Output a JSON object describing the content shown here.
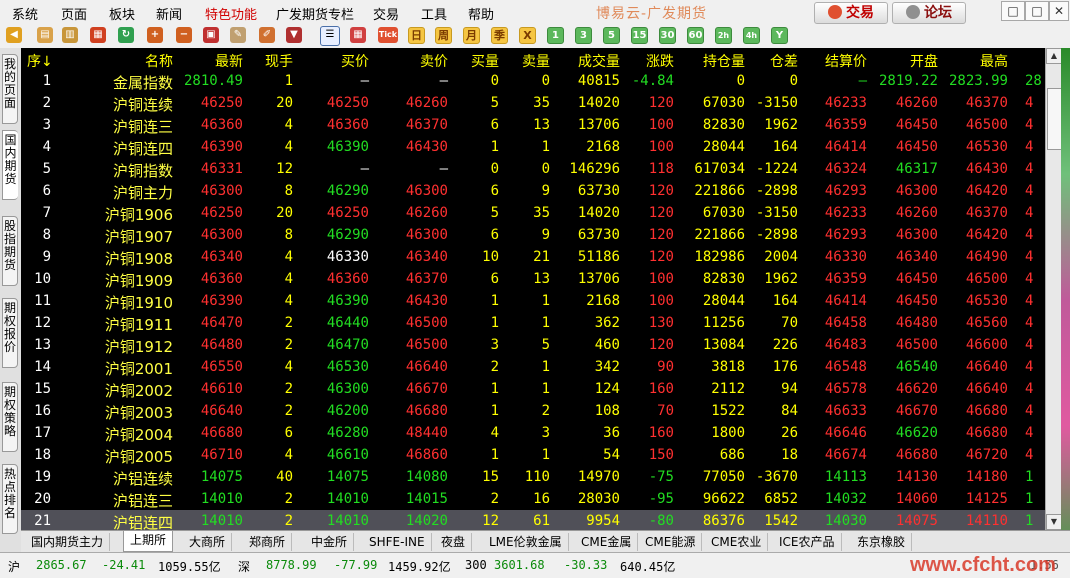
{
  "app_title": "博易云-广发期货",
  "menu": [
    "系统",
    "页面",
    "板块",
    "新闻",
    "特色功能",
    "广发期货专栏",
    "交易",
    "工具",
    "帮助"
  ],
  "buttons": {
    "trade": "交易",
    "forum": "论坛"
  },
  "window_controls": [
    "□",
    "□",
    "✕"
  ],
  "toolbar_icons": [
    "back-arrow-icon",
    "notepad-icon",
    "book-icon",
    "report-icon",
    "refresh-icon",
    "zoom-in-icon",
    "zoom-out-icon",
    "window-icon",
    "pencil-icon",
    "draw-icon",
    "filter-icon",
    "list-view-icon",
    "table-icon",
    "tick-icon"
  ],
  "toolbar": {
    "tick": "Tick",
    "periods": [
      "日",
      "周",
      "月",
      "季",
      "X"
    ],
    "minutes": [
      "1",
      "3",
      "5",
      "15",
      "30",
      "60",
      "2h",
      "4h",
      "Y"
    ]
  },
  "sidebar_tabs": [
    "我的页面",
    "国内期货",
    "股指期货",
    "期权报价",
    "期权策略",
    "热点排名"
  ],
  "columns": [
    "序↓",
    "名称",
    "最新",
    "现手",
    "买价",
    "卖价",
    "买量",
    "卖量",
    "成交量",
    "涨跌",
    "持仓量",
    "仓差",
    "结算价",
    "开盘",
    "最高",
    ""
  ],
  "rows": [
    [
      "1",
      "金属指数",
      "2810.49",
      "1",
      "—",
      "—",
      "0",
      "0",
      "40815",
      "-4.84",
      "0",
      "0",
      "—",
      "2819.22",
      "2823.99",
      "28"
    ],
    [
      "2",
      "沪铜连续",
      "46250",
      "20",
      "46250",
      "46260",
      "5",
      "35",
      "14020",
      "120",
      "67030",
      "-3150",
      "46233",
      "46260",
      "46370",
      "4"
    ],
    [
      "3",
      "沪铜连三",
      "46360",
      "4",
      "46360",
      "46370",
      "6",
      "13",
      "13706",
      "100",
      "82830",
      "1962",
      "46359",
      "46450",
      "46500",
      "4"
    ],
    [
      "4",
      "沪铜连四",
      "46390",
      "4",
      "46390",
      "46430",
      "1",
      "1",
      "2168",
      "100",
      "28044",
      "164",
      "46414",
      "46450",
      "46530",
      "4"
    ],
    [
      "5",
      "沪铜指数",
      "46331",
      "12",
      "—",
      "—",
      "0",
      "0",
      "146296",
      "118",
      "617034",
      "-1224",
      "46324",
      "46317",
      "46430",
      "4"
    ],
    [
      "6",
      "沪铜主力",
      "46300",
      "8",
      "46290",
      "46300",
      "6",
      "9",
      "63730",
      "120",
      "221866",
      "-2898",
      "46293",
      "46300",
      "46420",
      "4"
    ],
    [
      "7",
      "沪铜1906",
      "46250",
      "20",
      "46250",
      "46260",
      "5",
      "35",
      "14020",
      "120",
      "67030",
      "-3150",
      "46233",
      "46260",
      "46370",
      "4"
    ],
    [
      "8",
      "沪铜1907",
      "46300",
      "8",
      "46290",
      "46300",
      "6",
      "9",
      "63730",
      "120",
      "221866",
      "-2898",
      "46293",
      "46300",
      "46420",
      "4"
    ],
    [
      "9",
      "沪铜1908",
      "46340",
      "4",
      "46330",
      "46340",
      "10",
      "21",
      "51186",
      "120",
      "182986",
      "2004",
      "46330",
      "46340",
      "46490",
      "4"
    ],
    [
      "10",
      "沪铜1909",
      "46360",
      "4",
      "46360",
      "46370",
      "6",
      "13",
      "13706",
      "100",
      "82830",
      "1962",
      "46359",
      "46450",
      "46500",
      "4"
    ],
    [
      "11",
      "沪铜1910",
      "46390",
      "4",
      "46390",
      "46430",
      "1",
      "1",
      "2168",
      "100",
      "28044",
      "164",
      "46414",
      "46450",
      "46530",
      "4"
    ],
    [
      "12",
      "沪铜1911",
      "46470",
      "2",
      "46440",
      "46500",
      "1",
      "1",
      "362",
      "130",
      "11256",
      "70",
      "46458",
      "46480",
      "46560",
      "4"
    ],
    [
      "13",
      "沪铜1912",
      "46480",
      "2",
      "46470",
      "46500",
      "3",
      "5",
      "460",
      "120",
      "13084",
      "226",
      "46483",
      "46500",
      "46600",
      "4"
    ],
    [
      "14",
      "沪铜2001",
      "46550",
      "4",
      "46530",
      "46640",
      "2",
      "1",
      "342",
      "90",
      "3818",
      "176",
      "46548",
      "46540",
      "46640",
      "4"
    ],
    [
      "15",
      "沪铜2002",
      "46610",
      "2",
      "46300",
      "46670",
      "1",
      "1",
      "124",
      "160",
      "2112",
      "94",
      "46578",
      "46620",
      "46640",
      "4"
    ],
    [
      "16",
      "沪铜2003",
      "46640",
      "2",
      "46200",
      "46680",
      "1",
      "2",
      "108",
      "70",
      "1522",
      "84",
      "46633",
      "46670",
      "46680",
      "4"
    ],
    [
      "17",
      "沪铜2004",
      "46680",
      "6",
      "46280",
      "48440",
      "4",
      "3",
      "36",
      "160",
      "1800",
      "26",
      "46646",
      "46620",
      "46680",
      "4"
    ],
    [
      "18",
      "沪铜2005",
      "46710",
      "4",
      "46610",
      "46860",
      "1",
      "1",
      "54",
      "150",
      "686",
      "18",
      "46674",
      "46680",
      "46720",
      "4"
    ],
    [
      "19",
      "沪铝连续",
      "14075",
      "40",
      "14075",
      "14080",
      "15",
      "110",
      "14970",
      "-75",
      "77050",
      "-3670",
      "14113",
      "14130",
      "14180",
      "1"
    ],
    [
      "20",
      "沪铝连三",
      "14010",
      "2",
      "14010",
      "14015",
      "2",
      "16",
      "28030",
      "-95",
      "96622",
      "6852",
      "14032",
      "14060",
      "14125",
      "1"
    ],
    [
      "21",
      "沪铝连四",
      "14010",
      "2",
      "14010",
      "14020",
      "12",
      "61",
      "9954",
      "-80",
      "86376",
      "1542",
      "14030",
      "14075",
      "14110",
      "1"
    ]
  ],
  "selected_row": 21,
  "bottom_tabs": [
    "国内期货主力",
    "上期所",
    "大商所",
    "郑商所",
    "中金所",
    "SHFE-INE",
    "夜盘",
    "LME伦敦金属",
    "CME金属",
    "CME能源",
    "CME农业",
    "ICE农产品",
    "东京橡胶"
  ],
  "active_bottom_tab": 1,
  "status": {
    "sh_label": "沪",
    "sh_index": "2865.67",
    "sh_change": "-24.41",
    "sh_amount": "1059.55亿",
    "sz_label": "深",
    "sz_index": "8778.99",
    "sz_change": "-77.99",
    "sz_amount": "1459.92亿",
    "hs300_label": "300",
    "hs300_index": "3601.68",
    "hs300_change": "-30.33",
    "hs300_amount": "640.45亿",
    "time": "1:56",
    "watermark": "www.cfcht.com"
  },
  "colors": {
    "up": "#ff3030",
    "down": "#22dd22",
    "neutral": "#ffffff",
    "name": "#ffff44",
    "volume": "#ffff00",
    "header": "#ffff00"
  }
}
